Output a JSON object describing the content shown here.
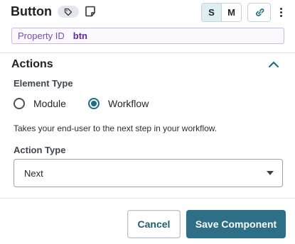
{
  "header": {
    "title": "Button",
    "tag_icon": "tag-icon",
    "note_icon": "note-icon",
    "size_options": [
      "S",
      "M"
    ],
    "size_selected": "S",
    "link_icon": "link-icon",
    "menu_icon": "kebab-menu-icon"
  },
  "property": {
    "label": "Property ID",
    "value": "btn"
  },
  "actions": {
    "title": "Actions",
    "collapse_icon": "chevron-up-icon",
    "element_type_label": "Element Type",
    "element_type_options": [
      "Module",
      "Workflow"
    ],
    "element_type_selected": "Workflow",
    "helper_text": "Takes your end-user to the next step in your workflow.",
    "action_type_label": "Action Type",
    "action_type_value": "Next"
  },
  "footer": {
    "cancel_label": "Cancel",
    "save_label": "Save Component"
  },
  "colors": {
    "accent": "#2d6f86",
    "property_text": "#7a4bb8"
  }
}
